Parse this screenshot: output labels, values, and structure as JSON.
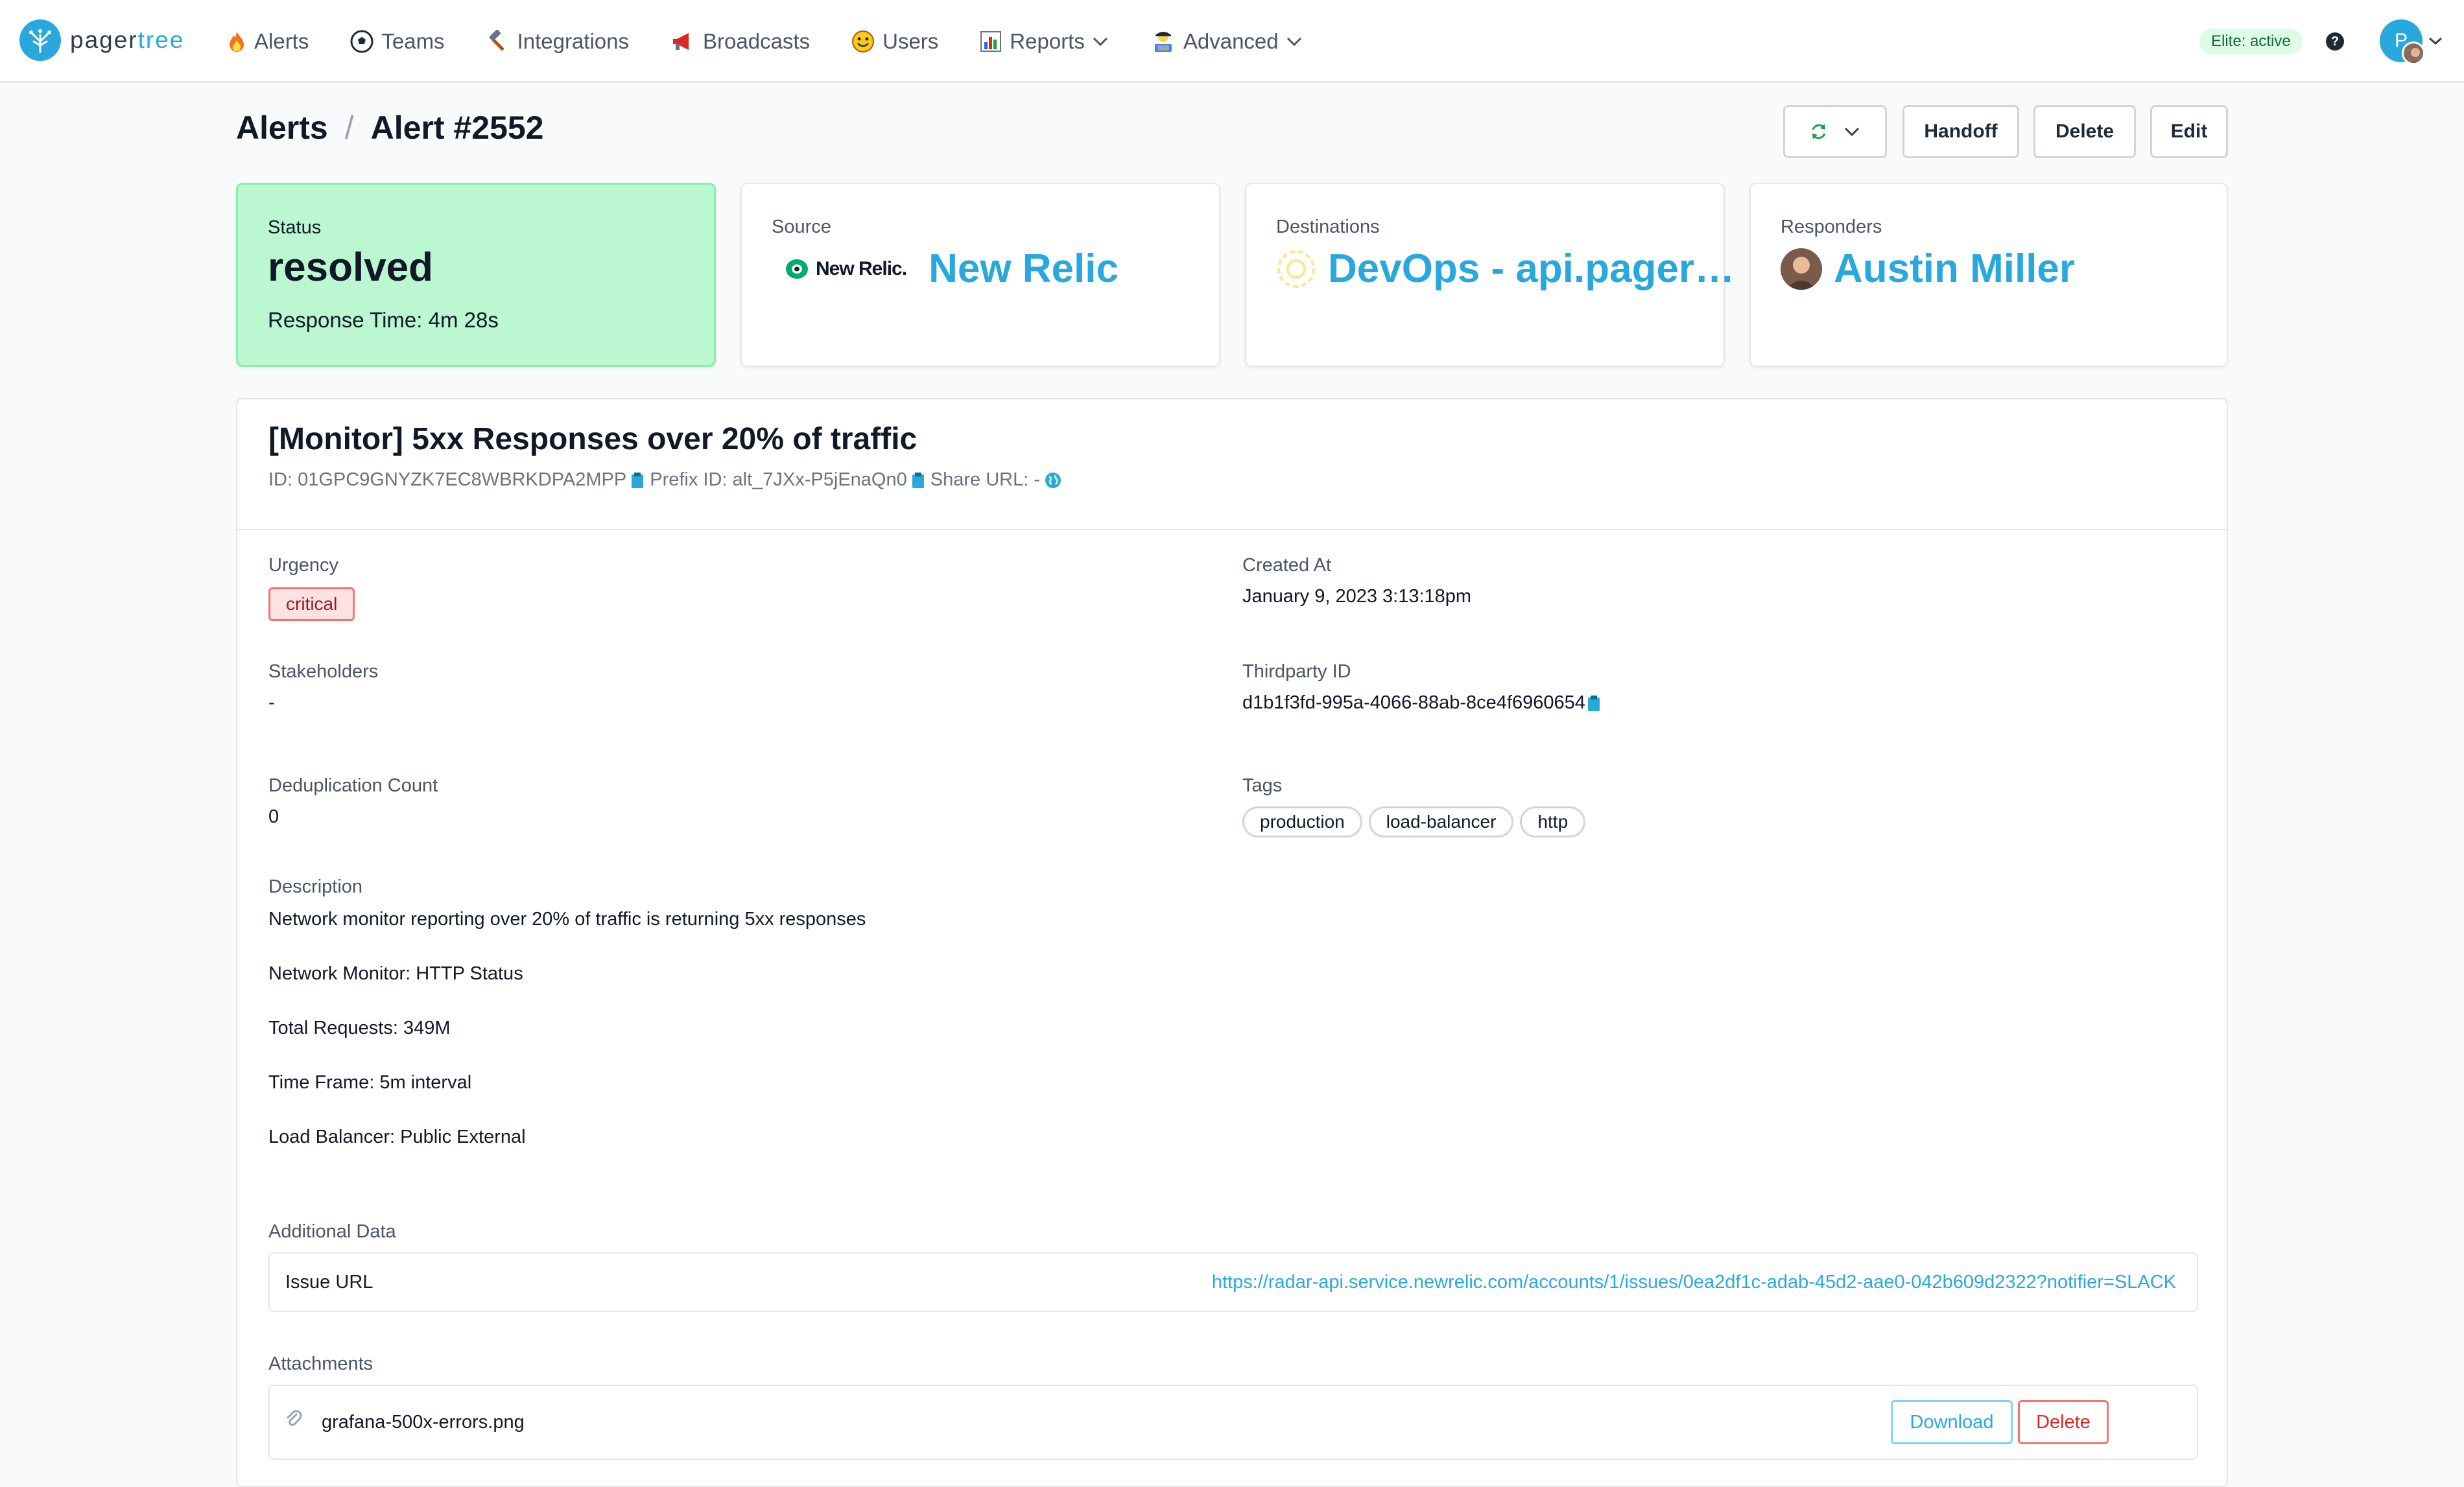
{
  "nav": {
    "logo_text_a": "pager",
    "logo_text_b": "tree",
    "items": [
      {
        "label": "Alerts",
        "icon": "fire-icon"
      },
      {
        "label": "Teams",
        "icon": "soccer-ball-icon"
      },
      {
        "label": "Integrations",
        "icon": "hammer-icon"
      },
      {
        "label": "Broadcasts",
        "icon": "megaphone-icon"
      },
      {
        "label": "Users",
        "icon": "smiley-icon"
      },
      {
        "label": "Reports",
        "icon": "bar-chart-icon"
      },
      {
        "label": "Advanced",
        "icon": "technologist-icon"
      }
    ],
    "elite_badge": "Elite: active",
    "help": "?",
    "avatar_initial": "P"
  },
  "header": {
    "crumb_root": "Alerts",
    "crumb_sep": "/",
    "crumb_current": "Alert #2552",
    "buttons": {
      "handoff": "Handoff",
      "delete": "Delete",
      "edit": "Edit"
    }
  },
  "cards": {
    "status": {
      "label": "Status",
      "value": "resolved",
      "response_time": "Response Time: 4m 28s"
    },
    "source": {
      "label": "Source",
      "logo_text": "New Relic.",
      "value": "New Relic"
    },
    "destinations": {
      "label": "Destinations",
      "value": "DevOps - api.pagertree.com"
    },
    "responders": {
      "label": "Responders",
      "value": "Austin Miller"
    }
  },
  "alert": {
    "title": "[Monitor] 5xx Responses over 20% of traffic",
    "id_text": "ID: 01GPC9GNYZK7EC8WBRKDPA2MPP",
    "prefix_id_text": "Prefix ID: alt_7JXx-P5jEnaQn0",
    "share_url_text": "Share URL: -",
    "urgency_label": "Urgency",
    "urgency_value": "critical",
    "created_label": "Created At",
    "created_value": "January 9, 2023 3:13:18pm",
    "stakeholders_label": "Stakeholders",
    "stakeholders_value": "-",
    "thirdparty_label": "Thirdparty ID",
    "thirdparty_value": "d1b1f3fd-995a-4066-88ab-8ce4f6960654",
    "dedup_label": "Deduplication Count",
    "dedup_value": "0",
    "tags_label": "Tags",
    "tags": [
      "production",
      "load-balancer",
      "http"
    ],
    "description_label": "Description",
    "description_lines": [
      "Network monitor reporting over 20% of traffic is returning 5xx responses",
      "Network Monitor: HTTP Status",
      "Total Requests: 349M",
      "Time Frame: 5m interval",
      "Load Balancer: Public External"
    ],
    "additional_label": "Additional Data",
    "additional_key": "Issue URL",
    "additional_value": "https://radar-api.service.newrelic.com/accounts/1/issues/0ea2df1c-adab-45d2-aae0-042b609d2322?notifier=SLACK",
    "attachments_label": "Attachments",
    "attachment_name": "grafana-500x-errors.png",
    "download_label": "Download",
    "attachment_delete_label": "Delete"
  },
  "colors": {
    "brand": "#29a8dd",
    "status_bg": "#bbf7d0",
    "critical": "#f87171"
  }
}
